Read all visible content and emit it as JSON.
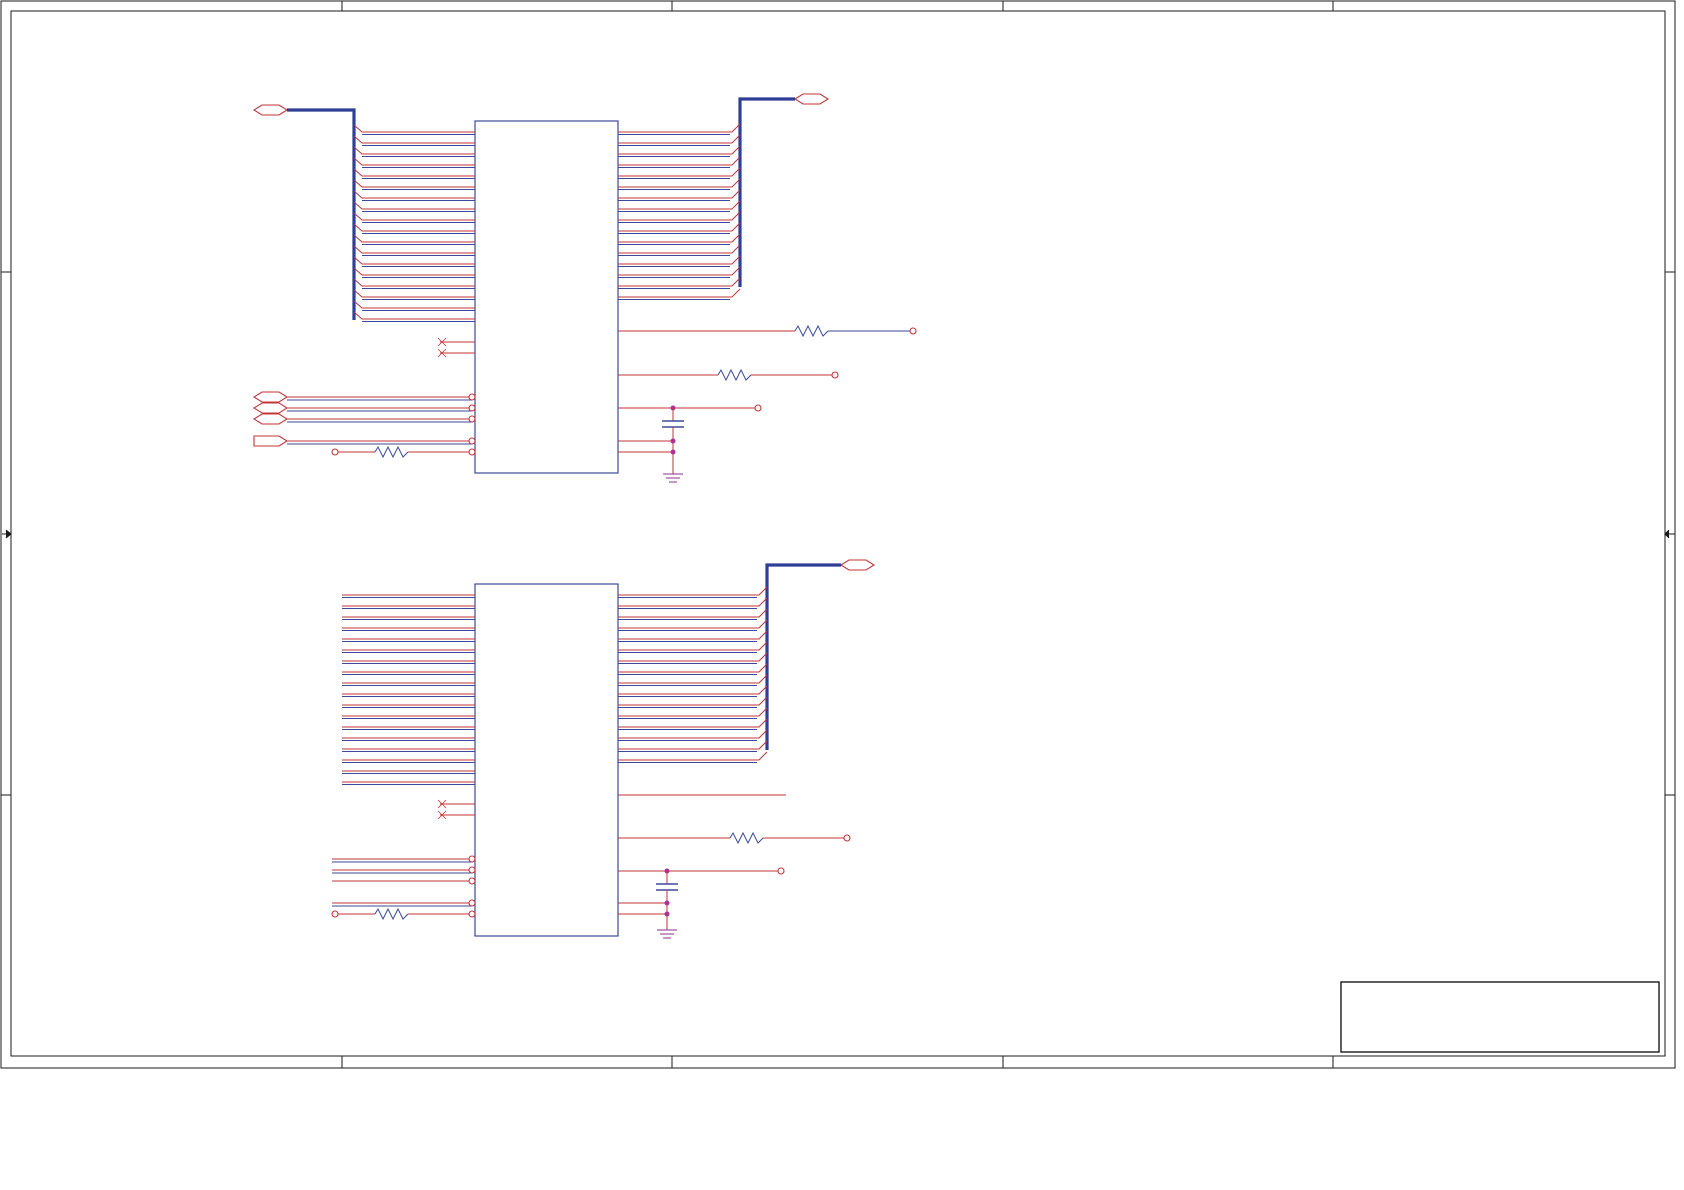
{
  "sheet": {
    "title_block": {}
  },
  "components": {
    "ic_top": {},
    "ic_bottom": {}
  },
  "colors": {
    "net_wire": "#c0353a",
    "bus": "#2f3f96",
    "component_outline": "#3b4a9a",
    "junction": "#b0309a",
    "frame": "#1a1a1a"
  }
}
